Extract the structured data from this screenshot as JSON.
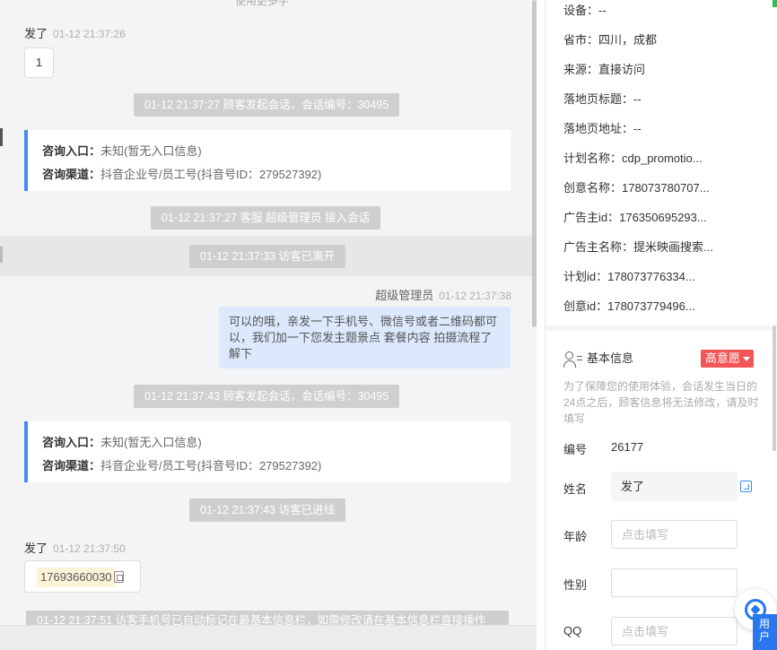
{
  "chat": {
    "top_cut_text": "使用更多字",
    "msg1": {
      "sender": "发了",
      "time": "01-12 21:37:26",
      "content": "1"
    },
    "sys1": "01-12 21:37:27 顾客发起会话，会话编号：30495",
    "card1": {
      "entry_label": "咨询入口：",
      "entry_value": "未知(暂无入口信息)",
      "channel_label": "咨询渠道：",
      "channel_value": "抖音企业号/员工号(抖音号ID：279527392)"
    },
    "sys2": "01-12 21:37:27 客服 超级管理员 接入会话",
    "sys3": "01-12 21:37:33 访客已离开",
    "agent_msg": {
      "sender": "超级管理员",
      "time": "01-12 21:37:38",
      "content": "可以的哦，亲发一下手机号、微信号或者二维码都可以，我们加一下您发主题景点 套餐内容 拍摄流程了解下"
    },
    "sys4": "01-12 21:37:43 顾客发起会话，会话编号：30495",
    "card2": {
      "entry_label": "咨询入口：",
      "entry_value": "未知(暂无入口信息)",
      "channel_label": "咨询渠道：",
      "channel_value": "抖音企业号/员工号(抖音号ID：279527392)"
    },
    "sys5": "01-12 21:37:43 访客已进线",
    "msg2": {
      "sender": "发了",
      "time": "01-12 21:37:50",
      "phone": "17693660030"
    },
    "sys6_partial": "01-12 21:37:51 访客手机号已自动标记在最基本信息栏，如需修改请在基本信息栏直接操作"
  },
  "side": {
    "visit_info": [
      "设备：--",
      "省市：四川，成都",
      "来源：直接访问",
      "落地页标题：--",
      "落地页地址：--",
      "计划名称：cdp_promotio...",
      "创意名称：178073780707...",
      "广告主id：176350695293...",
      "广告主名称：提米映画搜索...",
      "计划id：178073776334...",
      "创意id：178073779496..."
    ],
    "basic_title": "基本信息",
    "intent_badge": "高意愿",
    "notice": "为了保障您的使用体验，会话发生当日的24点之后，顾客信息将无法修改，请及时填写",
    "id_label": "编号",
    "id_value": "26177",
    "name_label": "姓名",
    "name_value": "发了",
    "age_label": "年龄",
    "age_placeholder": "点击填写",
    "gender_label": "性别",
    "qq_label": "QQ",
    "qq_placeholder": "点击填写",
    "user_tab": "用户",
    "colors": {
      "accent": "#2a78f0",
      "intent": "#f15555",
      "card_border": "#4a8af0",
      "agent_bubble": "#dce9fd"
    }
  }
}
